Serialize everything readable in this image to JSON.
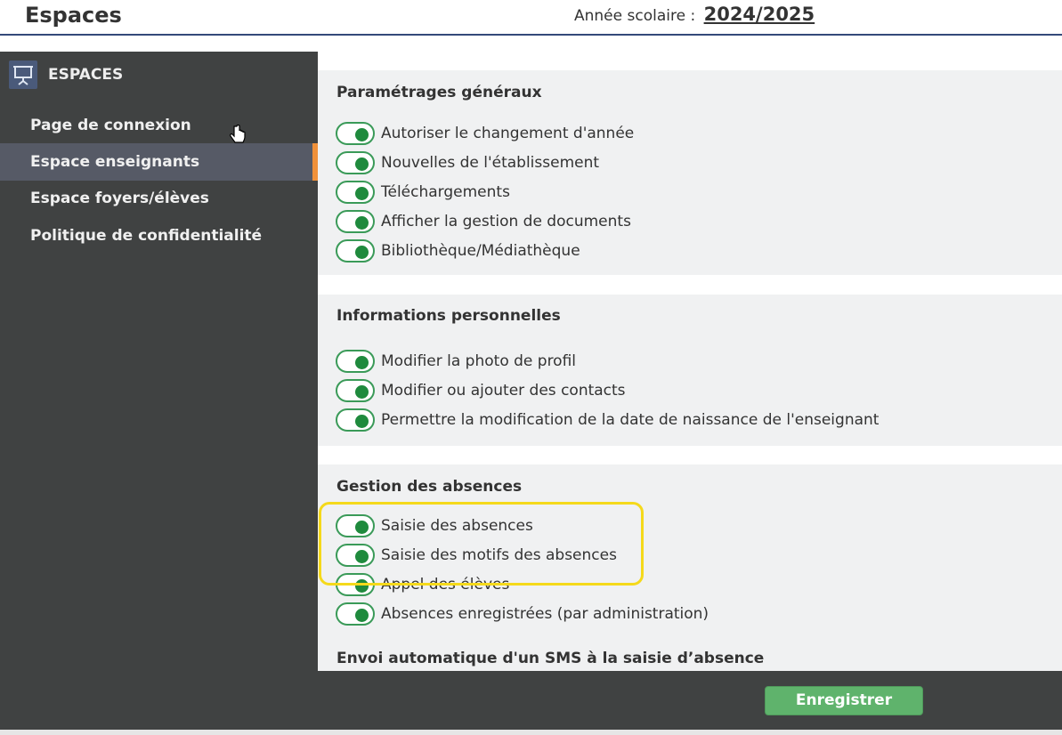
{
  "header": {
    "title": "Espaces",
    "year_label": "Année scolaire :",
    "year_value": "2024/2025"
  },
  "sidebar": {
    "title": "ESPACES",
    "icon": "presentation-board-icon",
    "items": [
      {
        "label": "Page de connexion",
        "active": false
      },
      {
        "label": "Espace enseignants",
        "active": true
      },
      {
        "label": "Espace foyers/élèves",
        "active": false
      },
      {
        "label": "Politique de confidentialité",
        "active": false
      }
    ]
  },
  "sections": [
    {
      "title": "Paramétrages généraux",
      "options": [
        {
          "label": "Autoriser le changement d'année",
          "enabled": true
        },
        {
          "label": "Nouvelles de l'établissement",
          "enabled": true
        },
        {
          "label": "Téléchargements",
          "enabled": true
        },
        {
          "label": "Afficher la gestion de documents",
          "enabled": true
        },
        {
          "label": "Bibliothèque/Médiathèque",
          "enabled": true
        }
      ]
    },
    {
      "title": "Informations personnelles",
      "options": [
        {
          "label": "Modifier la photo de profil",
          "enabled": true
        },
        {
          "label": "Modifier ou ajouter des contacts",
          "enabled": true
        },
        {
          "label": "Permettre la modification de la date de naissance de l'enseignant",
          "enabled": true
        }
      ]
    },
    {
      "title": "Gestion des absences",
      "options": [
        {
          "label": "Saisie des absences",
          "enabled": true
        },
        {
          "label": "Saisie des motifs des absences",
          "enabled": true
        },
        {
          "label": "Appel des élèves",
          "enabled": true
        },
        {
          "label": "Absences enregistrées (par administration)",
          "enabled": true
        }
      ],
      "subtitle": "Envoi automatique d'un SMS à la saisie d’absence"
    }
  ],
  "footer": {
    "save_label": "Enregistrer"
  },
  "colors": {
    "sidebar_bg": "#404242",
    "active_accent": "#f0913a",
    "toggle_on": "#1f8a3d",
    "save_button": "#5fb36c",
    "highlight": "#f5d91b"
  }
}
